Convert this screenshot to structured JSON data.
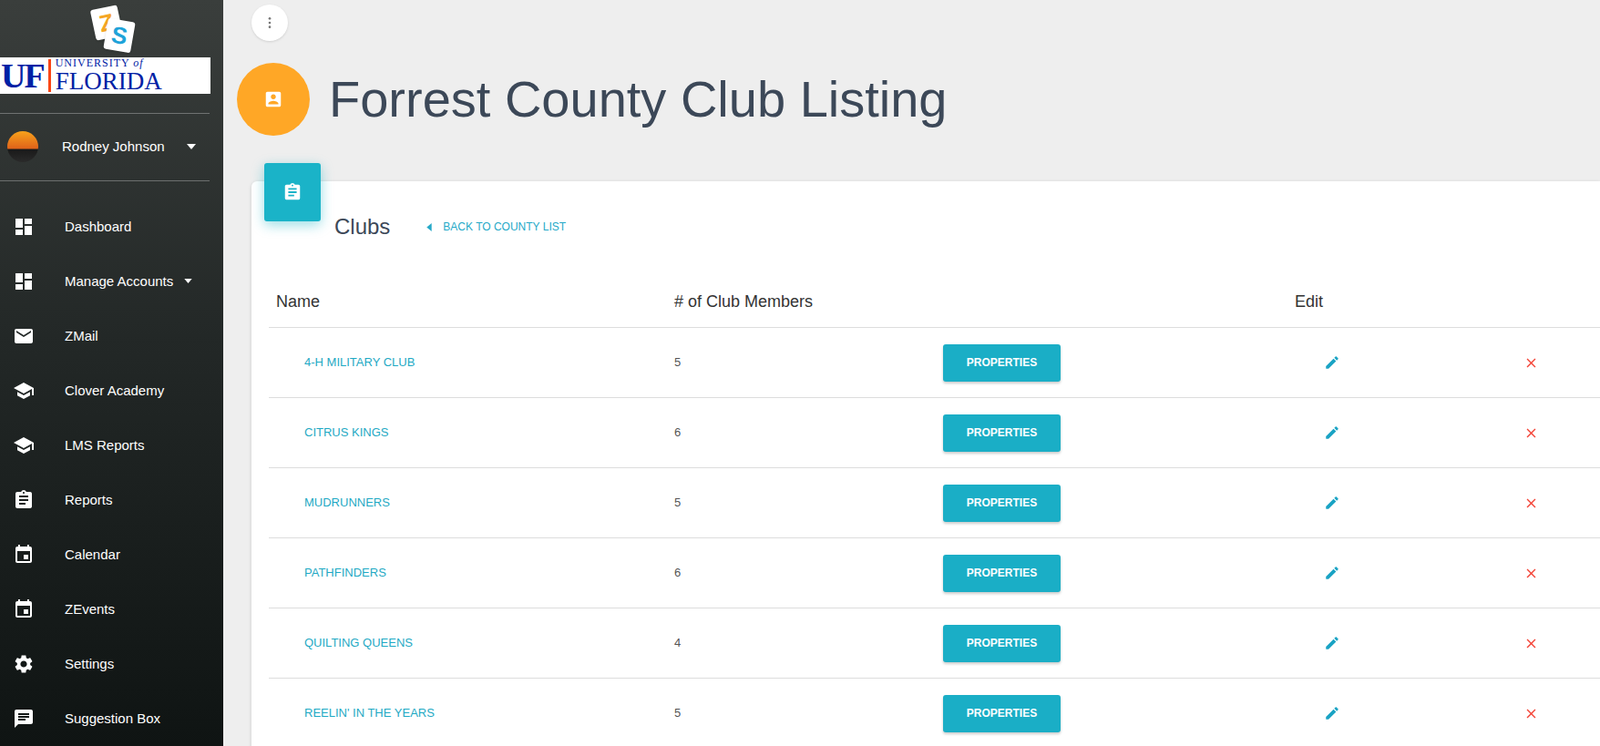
{
  "logo": {
    "mark_letters": [
      "Z",
      "S"
    ],
    "university_short": "UF",
    "university_top": "UNIVERSITY",
    "university_of": "of",
    "university_name": "FLORIDA"
  },
  "user": {
    "name": "Rodney Johnson",
    "menu_open": false
  },
  "sidebar": {
    "items": [
      {
        "label": "Dashboard",
        "selected": false
      },
      {
        "label": "Manage Accounts",
        "selected": false,
        "expanded": false
      },
      {
        "label": "ZMail",
        "selected": false
      },
      {
        "label": "Clover Academy",
        "selected": false
      },
      {
        "label": "LMS Reports",
        "selected": false
      },
      {
        "label": "Reports",
        "selected": false
      },
      {
        "label": "Calendar",
        "selected": false
      },
      {
        "label": "ZEvents",
        "selected": false
      },
      {
        "label": "Settings",
        "selected": false
      },
      {
        "label": "Suggestion Box",
        "selected": false
      }
    ]
  },
  "page": {
    "title": "Forrest County Club Listing"
  },
  "card": {
    "title": "Clubs",
    "back_link": "BACK TO COUNTY LIST"
  },
  "table": {
    "columns": [
      "Name",
      "# of Club Members",
      "Edit"
    ],
    "rows": [
      {
        "name": "4-H MILITARY CLUB",
        "members": "5",
        "action": "PROPERTIES"
      },
      {
        "name": "CITRUS KINGS",
        "members": "6",
        "action": "PROPERTIES"
      },
      {
        "name": "MUDRUNNERS",
        "members": "5",
        "action": "PROPERTIES"
      },
      {
        "name": "PATHFINDERS",
        "members": "6",
        "action": "PROPERTIES"
      },
      {
        "name": "QUILTING QUEENS",
        "members": "4",
        "action": "PROPERTIES"
      },
      {
        "name": "REELIN' IN THE YEARS",
        "members": "5",
        "action": "PROPERTIES"
      }
    ]
  }
}
